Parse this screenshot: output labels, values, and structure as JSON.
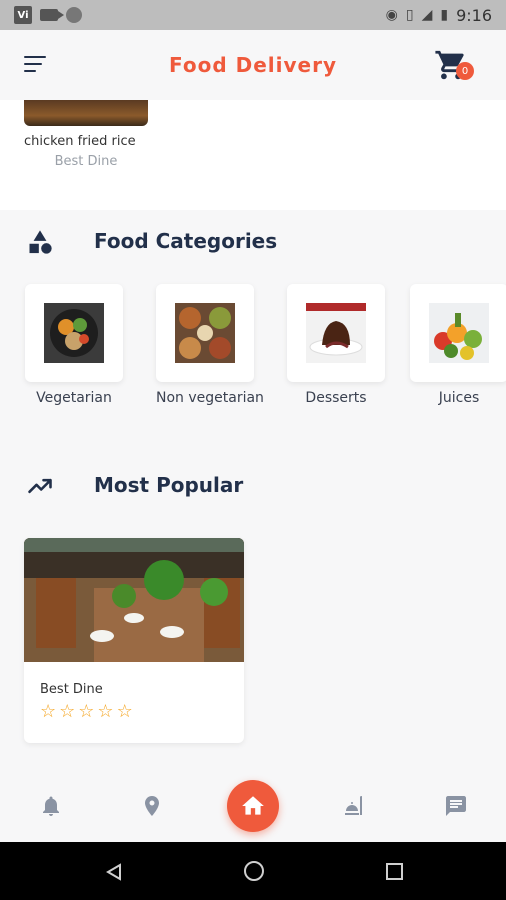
{
  "status_bar": {
    "carrier_icon": "Vi",
    "time": "9:16",
    "icons": [
      "video-icon",
      "circle-icon",
      "hotspot-icon",
      "vibrate-icon",
      "lte-signal-icon",
      "battery-icon"
    ]
  },
  "app_bar": {
    "title": "Food Delivery",
    "cart_count": "0",
    "menu_icon": "menu-icon",
    "cart_icon": "cart-icon"
  },
  "featured_item": {
    "name": "chicken fried rice",
    "restaurant": "Best Dine"
  },
  "categories_section": {
    "title": "Food Categories",
    "icon": "shapes-icon",
    "items": [
      {
        "label": "Vegetarian"
      },
      {
        "label": "Non vegetarian"
      },
      {
        "label": "Desserts"
      },
      {
        "label": "Juices"
      }
    ]
  },
  "popular_section": {
    "title": "Most Popular",
    "icon": "trending-up-icon",
    "items": [
      {
        "name": "Best Dine",
        "rating": 0,
        "max_rating": 5
      }
    ]
  },
  "bottom_nav": {
    "items": [
      "notifications-icon",
      "location-icon",
      "home-icon",
      "restaurant-icon",
      "chat-icon"
    ],
    "active": "home-icon"
  },
  "colors": {
    "accent": "#ef5a3c",
    "heading": "#22304a",
    "star": "#f5a623",
    "background": "#f7f7f8"
  }
}
